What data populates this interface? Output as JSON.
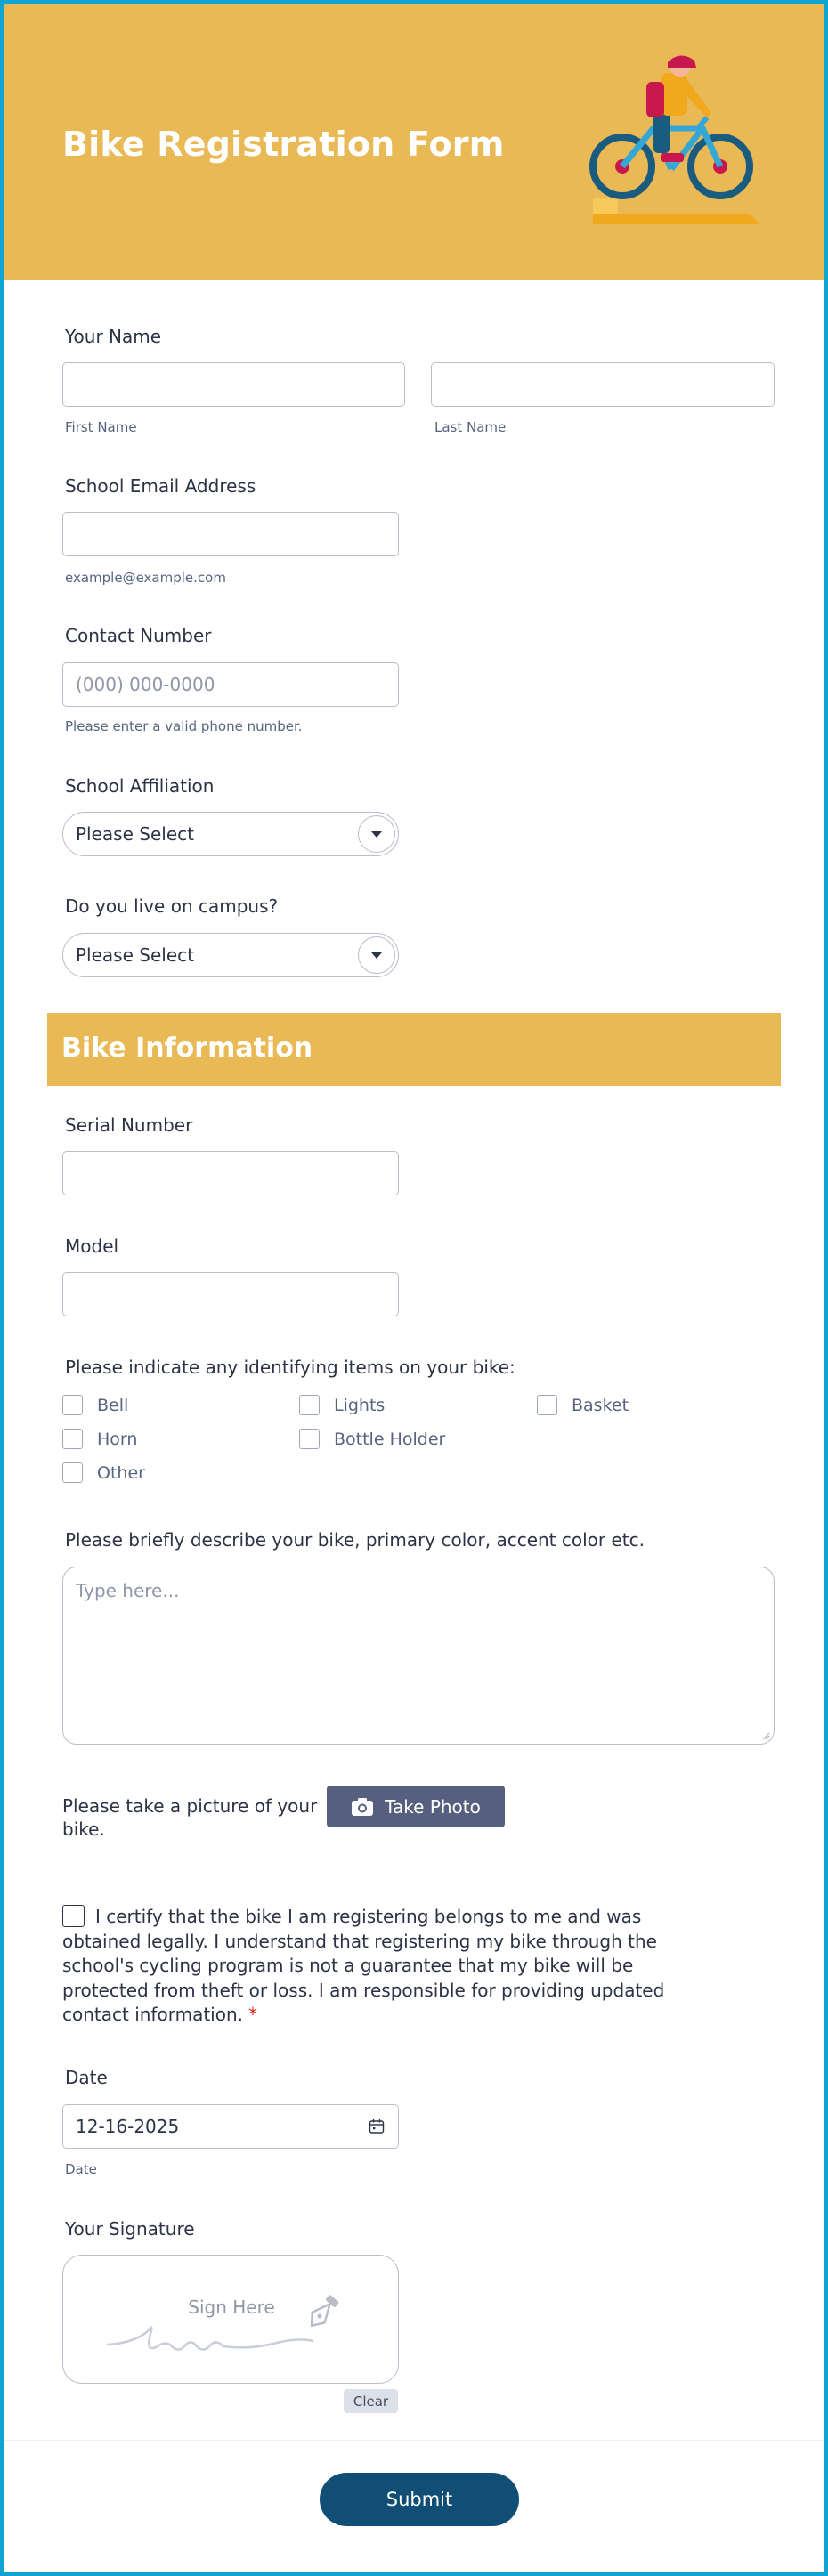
{
  "header": {
    "title": "Bike Registration Form"
  },
  "name": {
    "label": "Your Name",
    "first_sublabel": "First Name",
    "last_sublabel": "Last Name",
    "first_value": "",
    "last_value": ""
  },
  "email": {
    "label": "School Email Address",
    "value": "",
    "sublabel": "example@example.com"
  },
  "phone": {
    "label": "Contact Number",
    "placeholder": "(000) 000-0000",
    "sublabel": "Please enter a valid phone number."
  },
  "affiliation": {
    "label": "School Affiliation",
    "selected": "Please Select"
  },
  "campus": {
    "label": "Do you live on campus?",
    "selected": "Please Select"
  },
  "bike_section": {
    "title": "Bike Information"
  },
  "serial": {
    "label": "Serial Number",
    "value": ""
  },
  "model": {
    "label": "Model",
    "value": ""
  },
  "items": {
    "label": "Please indicate any identifying items on your bike:",
    "options": [
      "Bell",
      "Lights",
      "Basket",
      "Horn",
      "Bottle Holder",
      "Other"
    ]
  },
  "description": {
    "label": "Please briefly describe your bike, primary color, accent color etc.",
    "placeholder": "Type here..."
  },
  "photo": {
    "label": "Please take a picture of your bike.",
    "button_label": "Take Photo"
  },
  "certify": {
    "text": "I certify that the bike I am registering belongs to me and was obtained legally. I understand that registering my bike through the school's cycling program is not a guarantee that my bike will be protected from theft or loss. I am responsible for providing updated contact information.",
    "required_mark": "*"
  },
  "date": {
    "label": "Date",
    "value": "12-16-2025",
    "sublabel": "Date"
  },
  "signature": {
    "label": "Your Signature",
    "placeholder": "Sign Here",
    "clear_label": "Clear"
  },
  "submit": {
    "label": "Submit"
  },
  "colors": {
    "header_bg": "#e8b954",
    "frame_border": "#10a4d3",
    "submit_bg": "#114e76",
    "photo_btn_bg": "#56607e",
    "required": "#e02424"
  }
}
